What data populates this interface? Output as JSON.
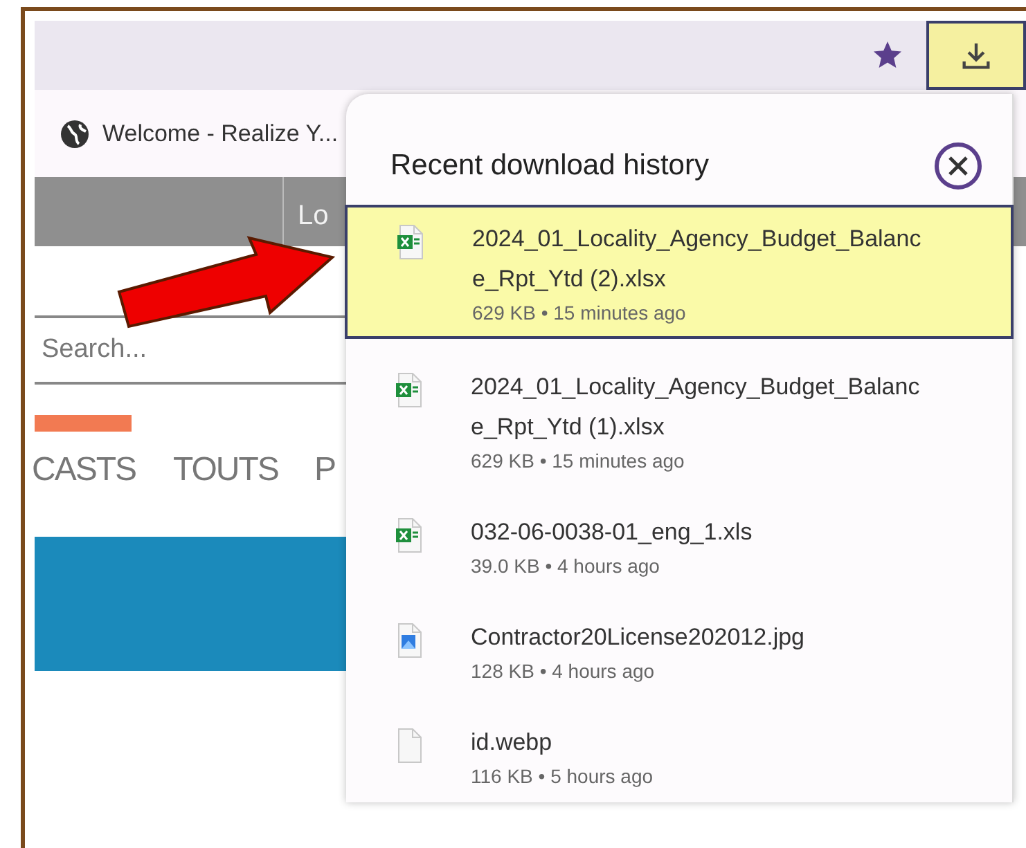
{
  "toolbar": {
    "download_button": {
      "highlighted": true
    }
  },
  "tab": {
    "title": "Welcome - Realize Y..."
  },
  "page": {
    "nav_bar_text": "Lo",
    "search": {
      "placeholder": "Search..."
    },
    "nav_links": [
      {
        "label": "CASTS"
      },
      {
        "label": "TOUTS"
      },
      {
        "label": "P"
      }
    ]
  },
  "downloads": {
    "title": "Recent download history",
    "items": [
      {
        "name": "2024_01_Locality_Agency_Budget_Balance_Rpt_Ytd (2).xlsx",
        "details": "629 KB • 15 minutes ago",
        "kind": "excel",
        "selected": true
      },
      {
        "name": "2024_01_Locality_Agency_Budget_Balance_Rpt_Ytd (1).xlsx",
        "details": "629 KB • 15 minutes ago",
        "kind": "excel",
        "selected": false
      },
      {
        "name": "032-06-0038-01_eng_1.xls",
        "details": "39.0 KB • 4 hours ago",
        "kind": "excel",
        "selected": false
      },
      {
        "name": "Contractor20License202012.jpg",
        "details": "128 KB • 4 hours ago",
        "kind": "image",
        "selected": false
      },
      {
        "name": "id.webp",
        "details": "116 KB • 5 hours ago",
        "kind": "other",
        "selected": false
      }
    ]
  }
}
